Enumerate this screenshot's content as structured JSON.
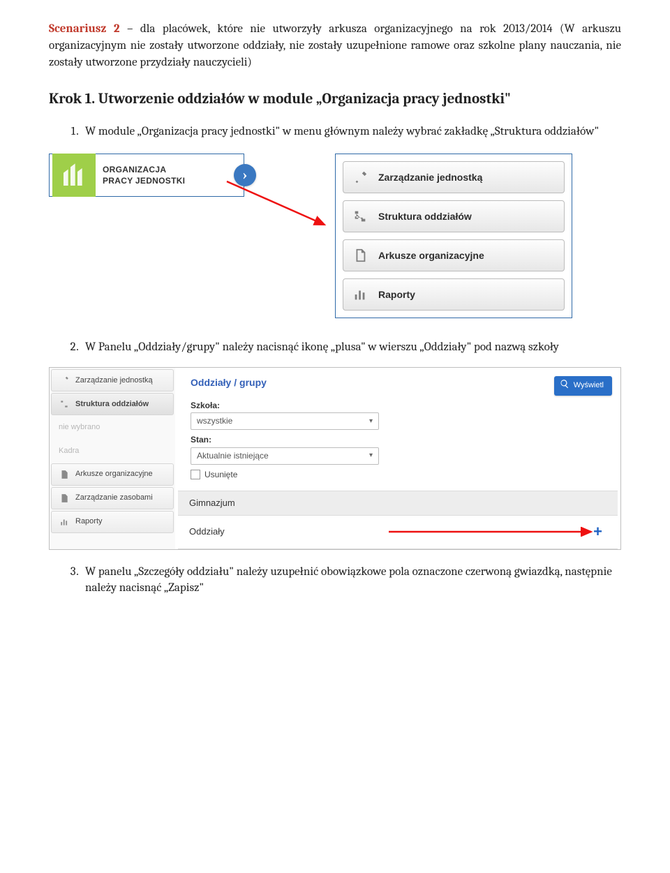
{
  "intro": {
    "scenario_label": "Scenariusz 2",
    "text": " – dla placówek, które nie utworzyły arkusza organizacyjnego na rok 2013/2014 (W arkuszu organizacyjnym nie zostały utworzone oddziały, nie zostały uzupełnione ramowe oraz szkolne plany nauczania, nie zostały utworzone przydziały nauczycieli)"
  },
  "krok1": {
    "heading": "Krok 1. Utworzenie oddziałów w module „Organizacja pracy jednostki\"",
    "step1": "W module „Organizacja pracy jednostki\" w menu głównym należy wybrać zakładkę „Struktura oddziałów\"",
    "step2": "W Panelu „Oddziały/grupy\" należy nacisnąć ikonę „plusa\" w wierszu „Oddziały\" pod nazwą szkoły",
    "step3": "W panelu „Szczegóły oddziału\" należy uzupełnić obowiązkowe pola oznaczone czerwoną gwiazdką, następnie należy nacisnąć „Zapisz\""
  },
  "module_card": {
    "line1": "ORGANIZACJA",
    "line2": "PRACY JEDNOSTKI"
  },
  "menu": {
    "items": [
      {
        "label": "Zarządzanie jednostką",
        "icon": "wrench-icon"
      },
      {
        "label": "Struktura oddziałów",
        "icon": "tree-icon"
      },
      {
        "label": "Arkusze organizacyjne",
        "icon": "sheets-icon"
      },
      {
        "label": "Raporty",
        "icon": "bars-icon"
      }
    ]
  },
  "sidebar": {
    "items": [
      {
        "label": "Zarządzanie jednostką",
        "icon": "wrench-icon",
        "state": "norm"
      },
      {
        "label": "Struktura oddziałów",
        "icon": "tree-icon",
        "state": "sel"
      },
      {
        "label": "nie wybrano",
        "icon": "",
        "state": "dis"
      },
      {
        "label": "Kadra",
        "icon": "",
        "state": "dis"
      },
      {
        "label": "Arkusze organizacyjne",
        "icon": "sheets-icon",
        "state": "norm"
      },
      {
        "label": "Zarządzanie zasobami",
        "icon": "sheets-icon",
        "state": "norm"
      },
      {
        "label": "Raporty",
        "icon": "bars-icon",
        "state": "norm"
      }
    ]
  },
  "panel": {
    "title": "Oddziały / grupy",
    "search_btn": "Wyświetl",
    "filter_school_label": "Szkoła:",
    "filter_school_value": "wszystkie",
    "filter_stan_label": "Stan:",
    "filter_stan_value": "Aktualnie istniejące",
    "filter_deleted": "Usunięte",
    "gim": "Gimnazjum",
    "odd": "Oddziały"
  }
}
